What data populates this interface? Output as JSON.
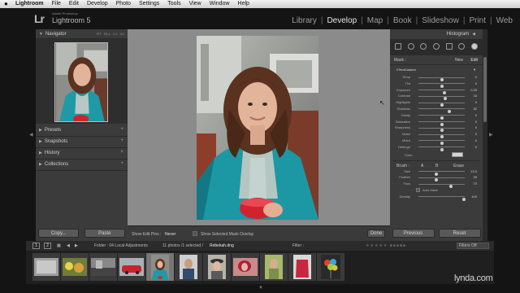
{
  "menubar": {
    "apple": "",
    "items": [
      "Lightroom",
      "File",
      "Edit",
      "Develop",
      "Photo",
      "Settings",
      "Tools",
      "View",
      "Window",
      "Help"
    ]
  },
  "identity": {
    "logo": "Lr",
    "subtitle": "Adobe Photoshop",
    "product": "Lightroom 5"
  },
  "modules": [
    "Library",
    "Develop",
    "Map",
    "Book",
    "Slideshow",
    "Print",
    "Web"
  ],
  "active_module": "Develop",
  "left_panel": {
    "navigator": {
      "title": "Navigator",
      "options": [
        "FIT",
        "FILL",
        "1:1",
        "4:1"
      ]
    },
    "sections": [
      "Presets",
      "Snapshots",
      "History",
      "Collections"
    ],
    "copy_label": "Copy...",
    "paste_label": "Paste"
  },
  "toolbar": {
    "show_edit_pins_label": "Show Edit Pins :",
    "show_edit_pins_value": "Never",
    "mask_overlay_label": "Show Selected Mask Overlay",
    "done_label": "Done"
  },
  "right_panel": {
    "histogram_title": "Histogram",
    "mask_label": "Mask :",
    "mask_new": "New",
    "mask_edit": "Edit",
    "effect_label": "Effect :",
    "effect_value": "Custom",
    "sliders": [
      {
        "name": "Temp",
        "value": "0",
        "pos": 0.5
      },
      {
        "name": "Tint",
        "value": "0",
        "pos": 0.5
      },
      {
        "name": "Exposure",
        "value": "0.39",
        "pos": 0.56
      },
      {
        "name": "Contrast",
        "value": "16",
        "pos": 0.58
      },
      {
        "name": "Highlights",
        "value": "0",
        "pos": 0.5
      },
      {
        "name": "Shadows",
        "value": "32",
        "pos": 0.66
      },
      {
        "name": "Clarity",
        "value": "0",
        "pos": 0.5
      },
      {
        "name": "Saturation",
        "value": "0",
        "pos": 0.5
      },
      {
        "name": "Sharpness",
        "value": "0",
        "pos": 0.5
      },
      {
        "name": "Noise",
        "value": "0",
        "pos": 0.5
      },
      {
        "name": "Moiré",
        "value": "0",
        "pos": 0.5
      },
      {
        "name": "Defringe",
        "value": "0",
        "pos": 0.5
      }
    ],
    "color_label": "Color",
    "brush": {
      "label": "Brush :",
      "a": "A",
      "b": "B",
      "erase": "Erase"
    },
    "brush_sliders": [
      {
        "name": "Size",
        "value": "13.0",
        "pos": 0.38
      },
      {
        "name": "Feather",
        "value": "39",
        "pos": 0.39
      },
      {
        "name": "Flow",
        "value": "70",
        "pos": 0.7
      }
    ],
    "auto_mask_label": "Auto Mask",
    "density": {
      "name": "Density",
      "value": "100",
      "pos": 0.98
    },
    "previous_label": "Previous",
    "reset_label": "Reset"
  },
  "filmstrip_bar": {
    "page1": "1",
    "page2": "2",
    "folder": "Folder : 04 Local Adjustments",
    "count": "11 photos /1 selected /",
    "filename": "Rebekah.dng",
    "filter_label": "Filter :",
    "filters_value": "Filters Off"
  },
  "filmstrip": {
    "thumbs": [
      "doc",
      "flowers",
      "bw-street",
      "car",
      "woman-teal",
      "man-portrait",
      "woman-hat",
      "woman-red",
      "man-field",
      "jacket",
      "balloons"
    ],
    "selected_index": 4
  },
  "watermark": "lynda.com"
}
